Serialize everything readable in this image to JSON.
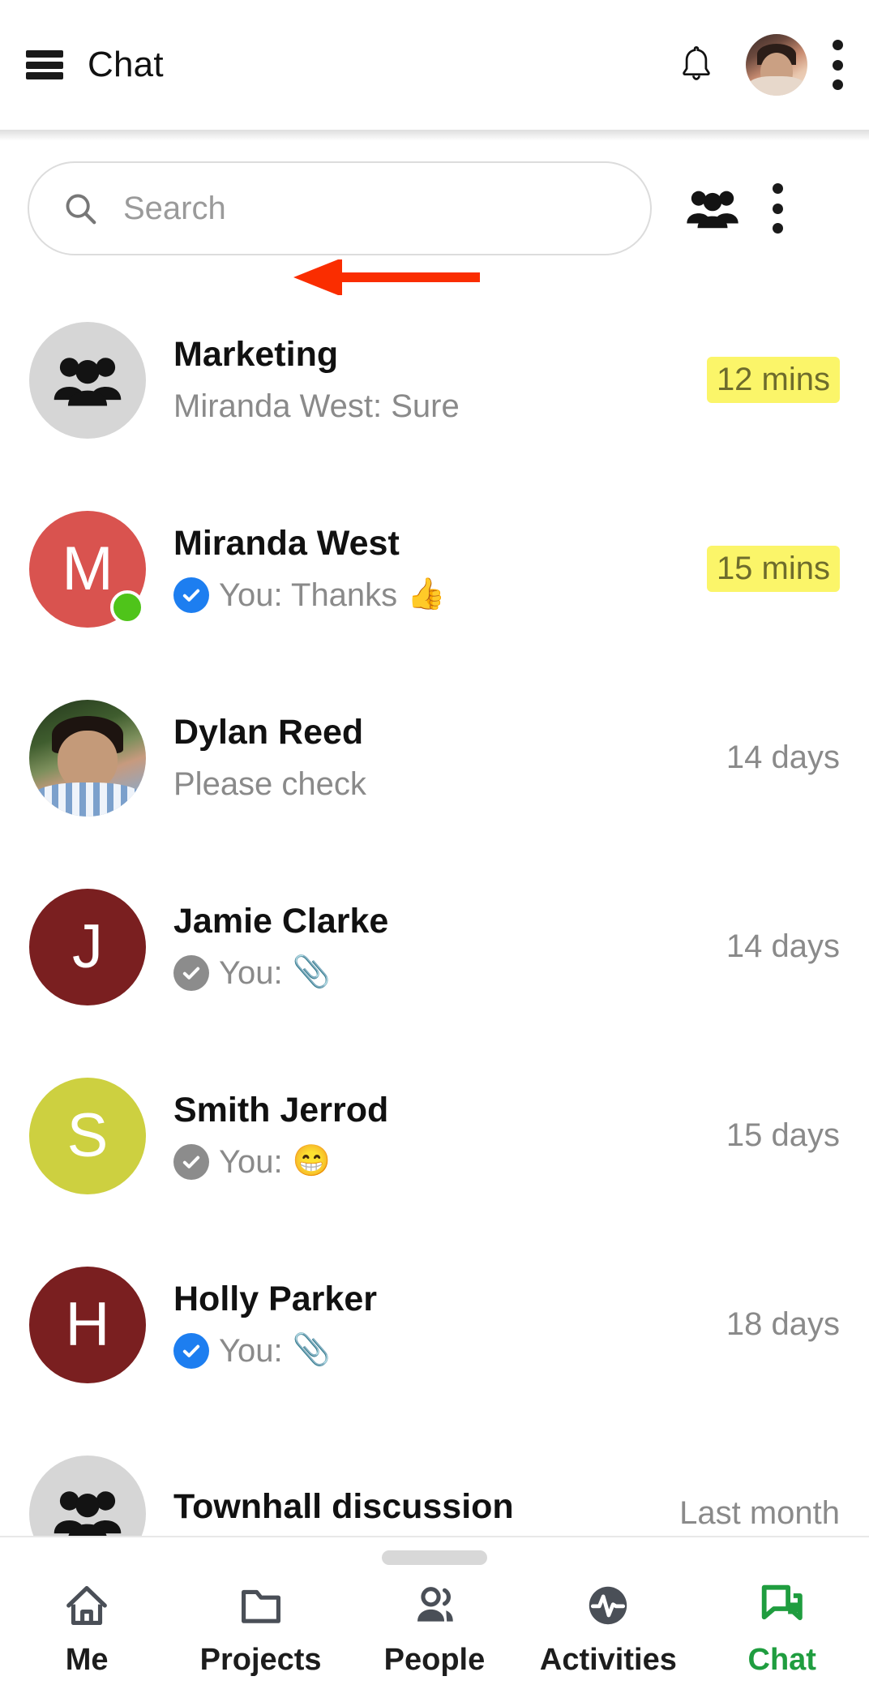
{
  "appbar": {
    "menu_icon": "hamburger-menu-icon",
    "title": "Chat",
    "bell_icon": "notification-bell-icon",
    "avatar_icon": "user-avatar",
    "overflow_icon": "more-vertical-icon"
  },
  "search": {
    "icon": "search-icon",
    "placeholder": "Search",
    "value": "",
    "groups_icon": "people-group-icon",
    "overflow_icon": "more-vertical-icon"
  },
  "annotation": {
    "type": "arrow",
    "color": "#fa2d00",
    "points_to": "Marketing"
  },
  "colors": {
    "accent_active": "#1f9d3f",
    "read_tick": "#1d7ef0",
    "sent_tick": "#8c8c8c",
    "online": "#4fc41a",
    "highlight": "#fbf569",
    "annotation": "#fa2d00"
  },
  "chats": [
    {
      "name": "Marketing",
      "avatar_kind": "group",
      "avatar_icon": "people-group-icon",
      "avatar_letter": "",
      "avatar_color": "#d6d6d6",
      "receipt": "none",
      "preview_prefix": "Miranda West: Sure",
      "preview_emoji": "",
      "time": "12 mins",
      "time_highlighted": true,
      "online": false
    },
    {
      "name": "Miranda West",
      "avatar_kind": "letter",
      "avatar_icon": "",
      "avatar_letter": "M",
      "avatar_color": "#d9534f",
      "receipt": "read",
      "preview_prefix": "You: Thanks",
      "preview_emoji": "👍",
      "time": "15 mins",
      "time_highlighted": true,
      "online": true
    },
    {
      "name": "Dylan Reed",
      "avatar_kind": "photo",
      "avatar_icon": "user-photo",
      "avatar_letter": "",
      "avatar_color": "#5b7a3f",
      "receipt": "none",
      "preview_prefix": "Please check",
      "preview_emoji": "",
      "time": "14 days",
      "time_highlighted": false,
      "online": false
    },
    {
      "name": "Jamie Clarke",
      "avatar_kind": "letter",
      "avatar_icon": "",
      "avatar_letter": "J",
      "avatar_color": "#7a1f20",
      "receipt": "sent",
      "preview_prefix": "You:",
      "preview_emoji": "📎",
      "time": "14 days",
      "time_highlighted": false,
      "online": false
    },
    {
      "name": "Smith Jerrod",
      "avatar_kind": "letter",
      "avatar_icon": "",
      "avatar_letter": "S",
      "avatar_color": "#cdd040",
      "receipt": "sent",
      "preview_prefix": "You:",
      "preview_emoji": "😁",
      "time": "15 days",
      "time_highlighted": false,
      "online": false
    },
    {
      "name": "Holly Parker",
      "avatar_kind": "letter",
      "avatar_icon": "",
      "avatar_letter": "H",
      "avatar_color": "#7a1f20",
      "receipt": "read",
      "preview_prefix": "You:",
      "preview_emoji": "📎",
      "time": "18 days",
      "time_highlighted": false,
      "online": false
    },
    {
      "name": "Townhall discussion",
      "avatar_kind": "group",
      "avatar_icon": "people-group-icon",
      "avatar_letter": "",
      "avatar_color": "#d6d6d6",
      "receipt": "none",
      "preview_prefix": "",
      "preview_emoji": "",
      "time": "Last month",
      "time_highlighted": false,
      "online": false
    }
  ],
  "bottom_nav": {
    "items": [
      {
        "label": "Me",
        "icon": "home-icon",
        "active": false
      },
      {
        "label": "Projects",
        "icon": "folder-icon",
        "active": false
      },
      {
        "label": "People",
        "icon": "person-icon",
        "active": false
      },
      {
        "label": "Activities",
        "icon": "pulse-icon",
        "active": false
      },
      {
        "label": "Chat",
        "icon": "chat-bubble-icon",
        "active": true
      }
    ]
  }
}
